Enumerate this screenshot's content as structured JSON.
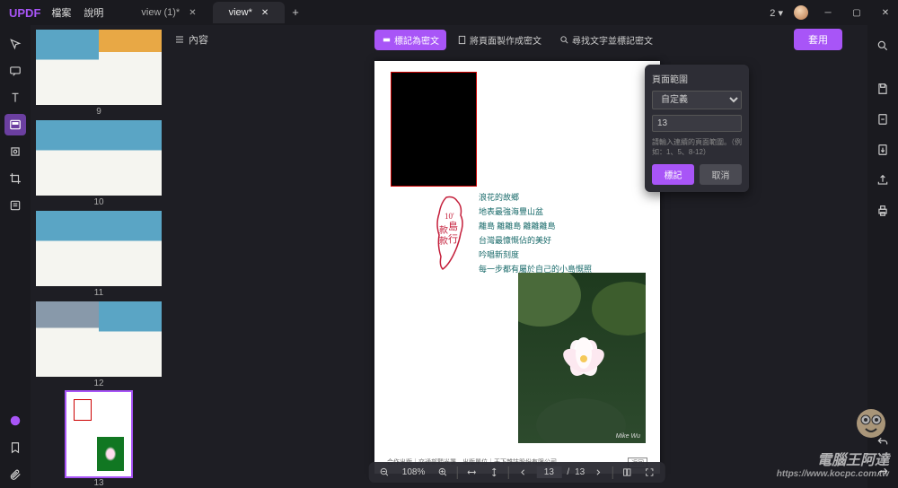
{
  "app": {
    "name": "UPDF"
  },
  "menu": {
    "file": "檔案",
    "help": "說明"
  },
  "tabs": [
    {
      "label": "view (1)*",
      "active": false
    },
    {
      "label": "view*",
      "active": true
    }
  ],
  "titlebar": {
    "badge": "2 ▾"
  },
  "left_sidebar_icons": [
    "pointer",
    "comment",
    "edit-text",
    "image",
    "stamp",
    "signature",
    "form"
  ],
  "left_bottom_icons": [
    "chat",
    "bookmark",
    "attachment"
  ],
  "right_icons": [
    "search",
    "save",
    "export-pdf",
    "export",
    "share",
    "print"
  ],
  "right_bottom_icons": [
    "undo",
    "redo"
  ],
  "thumbnails": [
    {
      "num": "9"
    },
    {
      "num": "10"
    },
    {
      "num": "11"
    },
    {
      "num": "12"
    },
    {
      "num": "13",
      "selected": true
    }
  ],
  "toolbar": {
    "toc": "內容",
    "mark_security": "標記為密文",
    "apply_to_pages": "將頁面製作成密文",
    "find_mark": "尋找文字並標記密文",
    "apply": "套用"
  },
  "popup": {
    "title": "頁面範圍",
    "select_label": "自定義",
    "input_value": "13",
    "hint": "請輸入連續的頁面範圍。（例如：1、5、8-12）",
    "confirm": "標記",
    "cancel": "取消"
  },
  "page_content": {
    "taiwan_text": "10'島款款行",
    "poem_lines": [
      "浪花的故鄉",
      "地表最強海豐山盆",
      "離島 離離島 離離離島",
      "台灣最慷慨佔的美好",
      "吟唱新刻度",
      "每一步都有屬於自己的小島慨照"
    ],
    "photo_credit": "Mike Wu",
    "footer_left": "合作出版｜交通部觀光署　出版單位｜天下雜誌股份有限公司",
    "footer_right": "返回"
  },
  "bottom_bar": {
    "zoom": "108%",
    "page_current": "13",
    "page_total": "13"
  },
  "watermark": {
    "text": "電腦王阿達",
    "url": "https://www.kocpc.com.tw"
  }
}
